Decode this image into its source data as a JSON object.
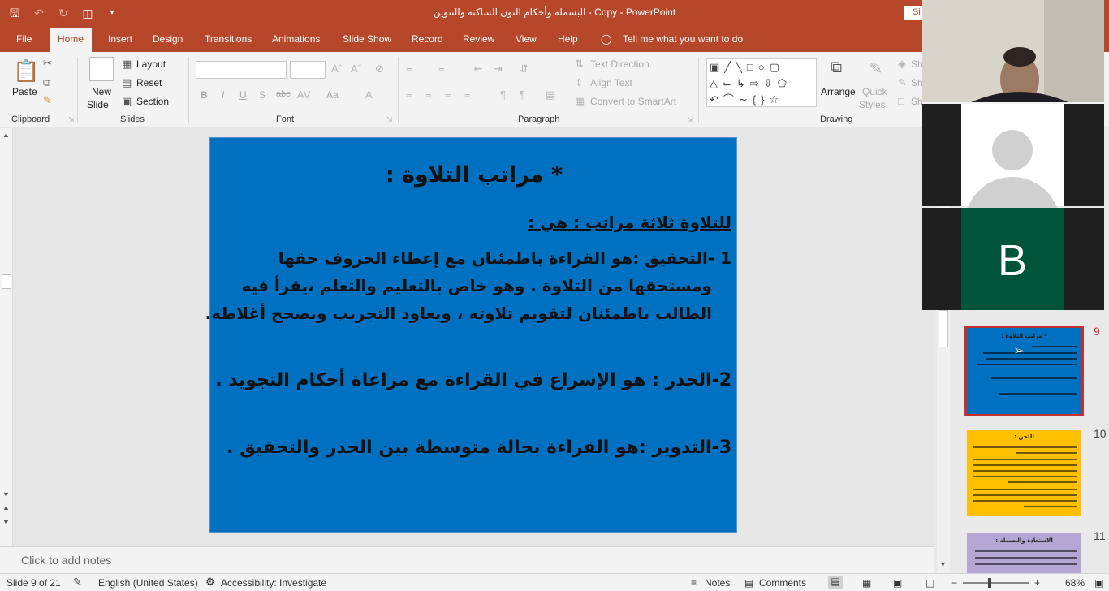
{
  "window": {
    "title": "البسملة وأحكام النون الساكنة والتنوين - Copy  -  PowerPoint",
    "signin_label": "Si"
  },
  "tabs": [
    "File",
    "Home",
    "Insert",
    "Design",
    "Transitions",
    "Animations",
    "Slide Show",
    "Record",
    "Review",
    "View",
    "Help"
  ],
  "active_tab": "Home",
  "tell_me": "Tell me what you want to do",
  "ribbon": {
    "clipboard": {
      "paste": "Paste",
      "label": "Clipboard"
    },
    "slides": {
      "new_slide_1": "New",
      "new_slide_2": "Slide",
      "layout": "Layout",
      "reset": "Reset",
      "section": "Section",
      "label": "Slides"
    },
    "font": {
      "label": "Font",
      "bold": "B",
      "italic": "I",
      "underline": "U",
      "shadow": "S",
      "strike": "abc",
      "aa": "Aa"
    },
    "paragraph": {
      "label": "Paragraph",
      "text_direction": "Text Direction",
      "align_text": "Align Text",
      "smartart": "Convert to SmartArt"
    },
    "drawing": {
      "label": "Drawing",
      "arrange": "Arrange",
      "quick_styles_1": "Quick",
      "quick_styles_2": "Styles",
      "sh1": "Sh",
      "sh2": "Sh",
      "sh3": "Sh"
    }
  },
  "slide": {
    "title": "* مراتب التلاوة :",
    "subtitle": "للتلاوة ثلاثة مراتب : هي :",
    "item1_line1": "1 -التحقيق :هو القراءة باطمئنان مع إعطاء الحروف حقها",
    "item1_line2": "ومستحقها من التلاوة . وهو خاص بالتعليم والتعلم ،يقرأ فيه",
    "item1_line3": "الطالب باطمئنان لتقويم تلاوته ، ويعاود التجريب ويصحح أغلاطه.",
    "item2": "2-الحدر : هو الإسراع في القراءة مع مراعاة أحكام التجويد .",
    "item3": "3-التدوير :هو القراءة بحالة متوسطة بين الحدر والتحقيق ."
  },
  "notes_placeholder": "Click to add notes",
  "thumbnails": [
    {
      "num": "9",
      "color": "#0070c0",
      "title": "* مراتب التلاوة :"
    },
    {
      "num": "10",
      "color": "#ffc000",
      "title": "اللحن :"
    },
    {
      "num": "11",
      "color": "#b4a7d6",
      "title": "الاستعاذة والبسملة :"
    }
  ],
  "video": {
    "participant_initial": "B"
  },
  "status": {
    "slide_of": "Slide 9 of 21",
    "language": "English (United States)",
    "accessibility": "Accessibility: Investigate",
    "notes": "Notes",
    "comments": "Comments",
    "zoom": "68%"
  },
  "colors": {
    "accent": "#b7472a",
    "slide_bg": "#0070c0",
    "selection": "#c5312f"
  }
}
